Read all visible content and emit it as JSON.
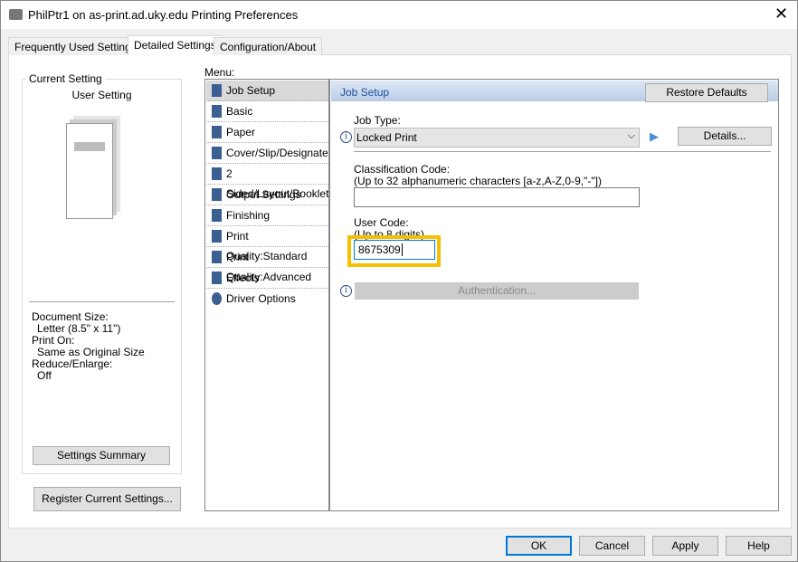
{
  "window": {
    "title": "PhilPtr1 on as-print.ad.uky.edu Printing Preferences",
    "close": "✕"
  },
  "tabs": [
    {
      "label": "Frequently Used Settings"
    },
    {
      "label": "Detailed Settings",
      "active": true
    },
    {
      "label": "Configuration/About"
    }
  ],
  "current": {
    "group_label": "Current Setting",
    "setting": "User Setting",
    "doc_size_label": "Document Size:",
    "doc_size": "Letter (8.5\" x 11\")",
    "print_on_label": "Print On:",
    "print_on": "Same as Original Size",
    "reduce_label": "Reduce/Enlarge:",
    "reduce": "Off",
    "summary_button": "Settings Summary",
    "register_button": "Register Current Settings..."
  },
  "menu": {
    "label": "Menu:",
    "items": [
      "Job Setup",
      "Basic",
      "Paper",
      "Cover/Slip/Designate",
      "2 Sided/Layout/Booklet",
      "Output Settings",
      "Finishing",
      "Print Quality:Standard",
      "Print Quality:Advanced",
      "Effects",
      "Driver Options"
    ],
    "selected": "Job Setup"
  },
  "job": {
    "header": "Job Setup",
    "restore": "Restore Defaults",
    "type_label": "Job Type:",
    "type_value": "Locked Print",
    "details": "Details...",
    "class_label": "Classification Code:",
    "class_hint": "(Up to 32 alphanumeric characters [a-z,A-Z,0-9,\"-\"])",
    "class_value": "",
    "user_label": "User Code:",
    "user_hint": "(Up to 8 digits)",
    "user_value": "8675309",
    "auth": "Authentication...",
    "highlight_color": "#f5c000"
  },
  "buttons": {
    "ok": "OK",
    "cancel": "Cancel",
    "apply": "Apply",
    "help": "Help"
  }
}
